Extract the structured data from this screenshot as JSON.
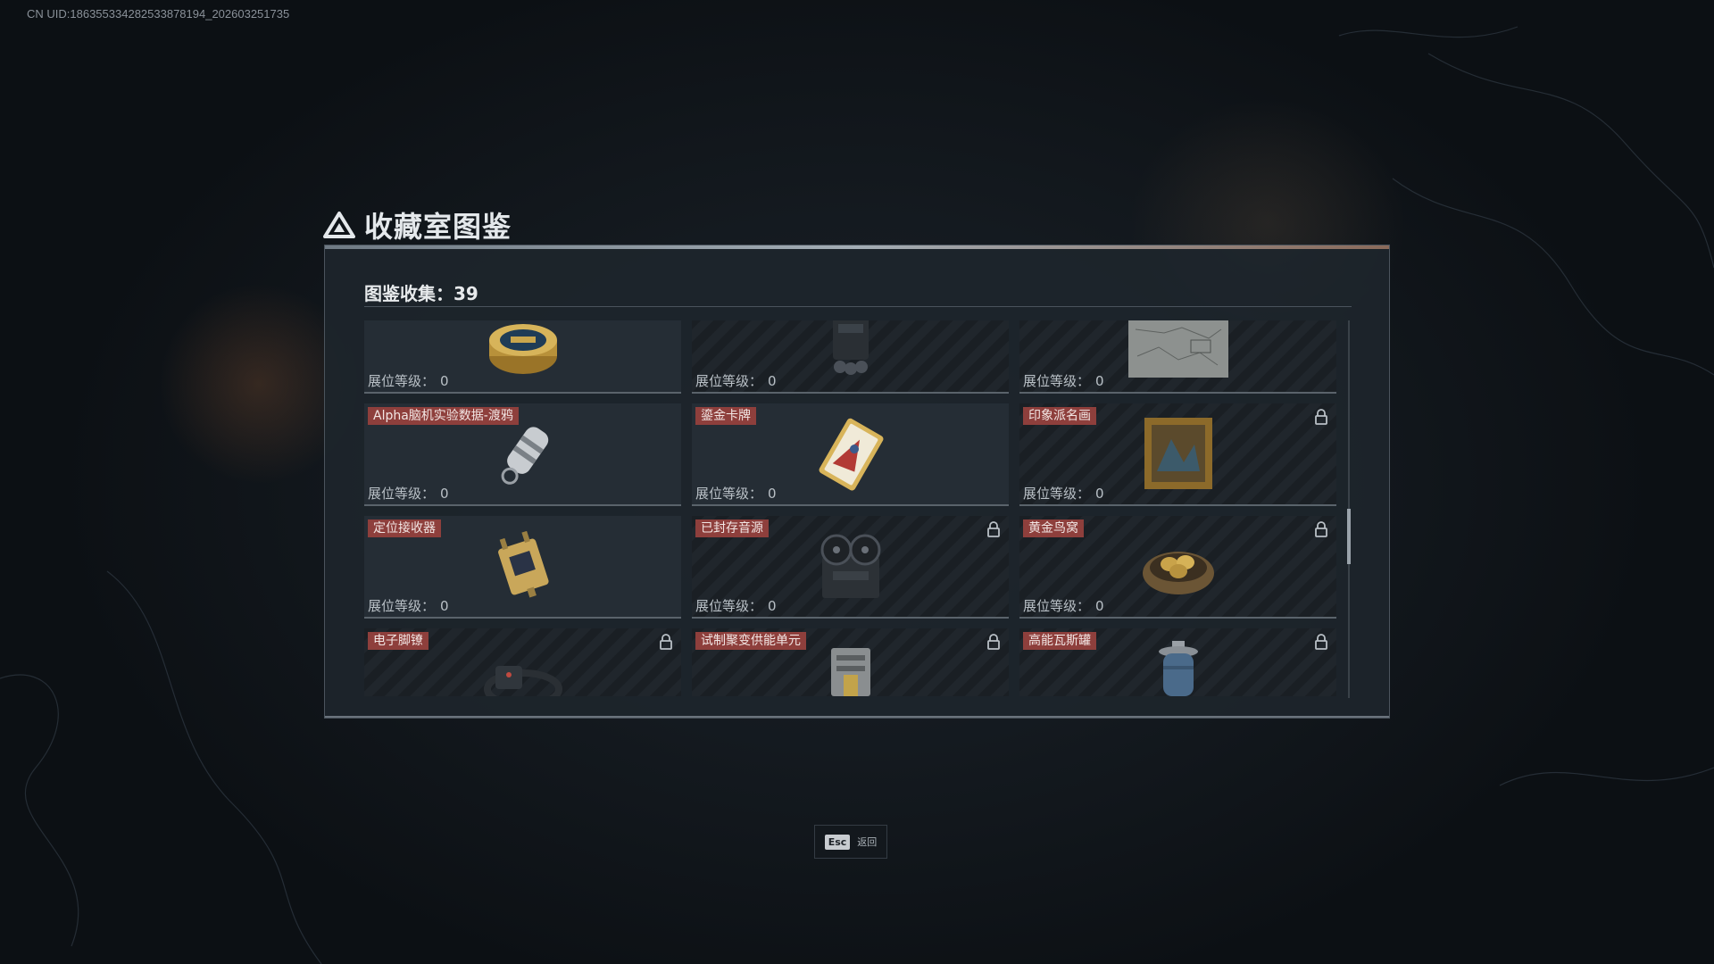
{
  "uid": "CN UID:18635533428253387819​4_202603251735",
  "panel": {
    "title": "收藏室图鉴",
    "count_label": "图鉴收集：39",
    "level_label": "展位等级："
  },
  "items": [
    {
      "name": "",
      "level": "0",
      "locked": false,
      "icon": "caviar-tin-icon"
    },
    {
      "name": "",
      "level": "0",
      "locked": true,
      "icon": "device-icon"
    },
    {
      "name": "",
      "level": "0",
      "locked": true,
      "icon": "map-icon"
    },
    {
      "name": "Alpha脑机实验数据-渡鸦",
      "level": "0",
      "locked": false,
      "icon": "data-capsule-icon"
    },
    {
      "name": "鎏金卡牌",
      "level": "0",
      "locked": false,
      "icon": "gold-card-icon"
    },
    {
      "name": "印象派名画",
      "level": "0",
      "locked": true,
      "icon": "painting-icon"
    },
    {
      "name": "定位接收器",
      "level": "0",
      "locked": false,
      "icon": "receiver-icon"
    },
    {
      "name": "已封存音源",
      "level": "0",
      "locked": true,
      "icon": "reel-recorder-icon"
    },
    {
      "name": "黄金鸟窝",
      "level": "0",
      "locked": true,
      "icon": "golden-nest-icon"
    },
    {
      "name": "电子脚镣",
      "level": "",
      "locked": true,
      "icon": "ankle-monitor-icon"
    },
    {
      "name": "试制聚变供能单元",
      "level": "",
      "locked": true,
      "icon": "fusion-unit-icon"
    },
    {
      "name": "高能瓦斯罐",
      "level": "",
      "locked": true,
      "icon": "gas-canister-icon"
    }
  ],
  "footer": {
    "esc_key": "Esc",
    "esc_label": "返回"
  },
  "colors": {
    "tag_bg": "#8e3f3c",
    "panel_bg": "#1e252c"
  }
}
